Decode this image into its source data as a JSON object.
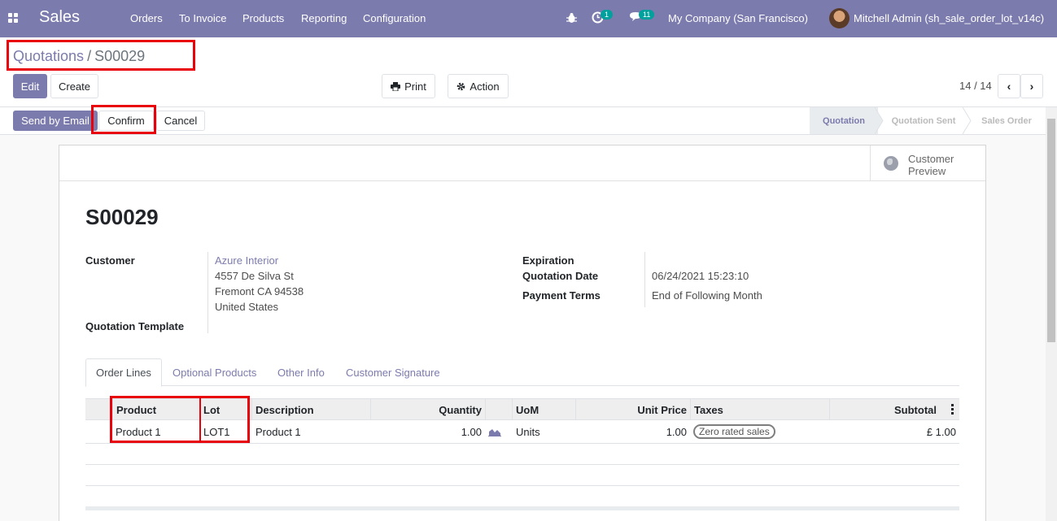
{
  "navbar": {
    "app_name": "Sales",
    "menu": [
      "Orders",
      "To Invoice",
      "Products",
      "Reporting",
      "Configuration"
    ],
    "activity_count": "1",
    "messages_count": "11",
    "company": "My Company (San Francisco)",
    "user": "Mitchell Admin (sh_sale_order_lot_v14c)"
  },
  "breadcrumb": {
    "parent": "Quotations",
    "separator": "/",
    "current": "S00029"
  },
  "toolbar": {
    "edit": "Edit",
    "create": "Create",
    "print": "Print",
    "action": "Action",
    "pager": "14 / 14"
  },
  "header_buttons": {
    "send_email": "Send by Email",
    "confirm": "Confirm",
    "cancel": "Cancel"
  },
  "stages": [
    {
      "label": "Quotation",
      "active": true
    },
    {
      "label": "Quotation Sent",
      "active": false
    },
    {
      "label": "Sales Order",
      "active": false
    }
  ],
  "sheet": {
    "preview_label": "Customer Preview",
    "title": "S00029",
    "customer_label": "Customer",
    "customer_name": "Azure Interior",
    "address": [
      "4557 De Silva St",
      "Fremont CA 94538",
      "United States"
    ],
    "template_label": "Quotation Template",
    "expiration_label": "Expiration",
    "quotation_date_label": "Quotation Date",
    "quotation_date": "06/24/2021 15:23:10",
    "payment_terms_label": "Payment Terms",
    "payment_terms": "End of Following Month"
  },
  "tabs": [
    "Order Lines",
    "Optional Products",
    "Other Info",
    "Customer Signature"
  ],
  "order_lines": {
    "headers": [
      "Product",
      "Lot",
      "Description",
      "Quantity",
      "UoM",
      "Unit Price",
      "Taxes",
      "Subtotal"
    ],
    "rows": [
      {
        "product": "Product 1",
        "lot": "LOT1",
        "description": "Product 1",
        "quantity": "1.00",
        "uom": "Units",
        "unit_price": "1.00",
        "taxes": "Zero rated sales",
        "subtotal": "£ 1.00"
      }
    ]
  },
  "colors": {
    "brand": "#7c7bad",
    "highlight": "#e8000b",
    "badge": "#00a09d"
  }
}
